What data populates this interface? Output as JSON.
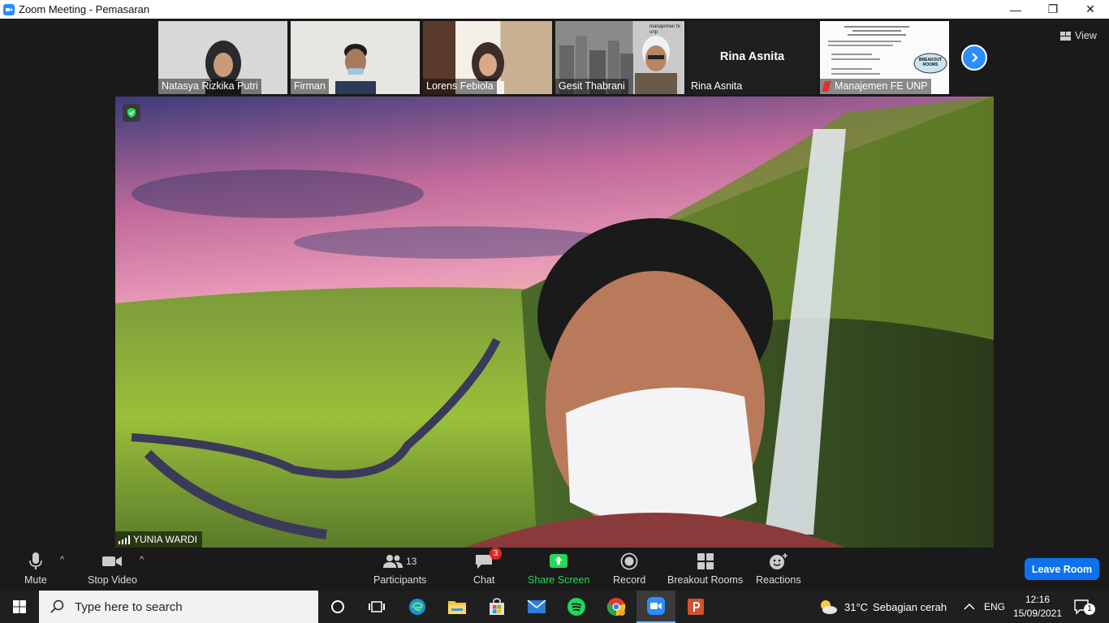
{
  "window": {
    "title": "Zoom Meeting - Pemasaran",
    "minimize": "—",
    "restore": "❐",
    "close": "✕"
  },
  "gallery": {
    "view_label": "View",
    "participants": [
      {
        "name": "Natasya Rizkika Putri"
      },
      {
        "name": "Firman"
      },
      {
        "name": "Lorens Febiola"
      },
      {
        "name": "Gesit Thabrani",
        "background_text": "manajemen fe unp"
      },
      {
        "name": "Rina Asnita",
        "big_name": "Rina Asnita"
      },
      {
        "name": "Manajemen FE UNP",
        "slide_badge": "BREAKOUT ROOMS"
      }
    ]
  },
  "speaker": {
    "name": "YUNIA WARDI"
  },
  "toolbar": {
    "mute": "Mute",
    "stop_video": "Stop Video",
    "participants": "Participants",
    "participants_count": "13",
    "chat": "Chat",
    "chat_badge": "3",
    "share_screen": "Share Screen",
    "record": "Record",
    "breakout_rooms": "Breakout Rooms",
    "reactions": "Reactions",
    "leave_room": "Leave Room",
    "share_color": "#23d959",
    "leave_color": "#0e72ed"
  },
  "taskbar": {
    "search_placeholder": "Type here to search",
    "weather_temp": "31°C",
    "weather_text": "Sebagian cerah",
    "language": "ENG",
    "time": "12:16",
    "date": "15/09/2021",
    "notification_count": "1"
  }
}
